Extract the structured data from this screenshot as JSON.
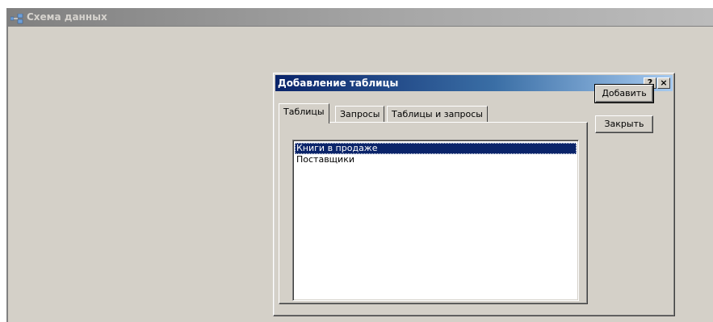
{
  "outer_window": {
    "title": "Схема данных",
    "icon": "relationships-icon"
  },
  "dialog": {
    "title": "Добавление таблицы",
    "help_label": "?",
    "close_label": "×",
    "tabs": [
      {
        "label": "Таблицы",
        "active": true
      },
      {
        "label": "Запросы",
        "active": false
      },
      {
        "label": "Таблицы и запросы",
        "active": false
      }
    ],
    "list_items": [
      {
        "label": "Книги в продаже",
        "selected": true
      },
      {
        "label": "Поставщики",
        "selected": false
      }
    ],
    "add_button": "Добавить",
    "close_button": "Закрыть"
  },
  "colors": {
    "window_bg": "#d4d0c8",
    "active_title_start": "#0a246a",
    "active_title_end": "#a6caf0",
    "selection": "#0a246a"
  }
}
